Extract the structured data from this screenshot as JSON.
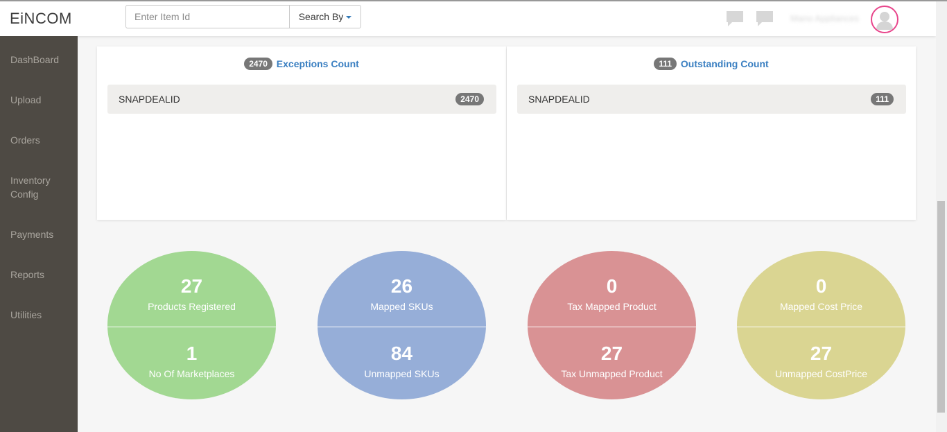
{
  "header": {
    "logo": "EiNCOM",
    "search_placeholder": "Enter Item Id",
    "search_by_label": "Search By",
    "user_name": "Mano Appliances"
  },
  "sidebar": {
    "items": [
      {
        "label": "DashBoard"
      },
      {
        "label": "Upload"
      },
      {
        "label": "Orders"
      },
      {
        "label": "Inventory Config"
      },
      {
        "label": "Payments"
      },
      {
        "label": "Reports"
      },
      {
        "label": "Utilities"
      }
    ]
  },
  "panels": {
    "exceptions": {
      "count": "2470",
      "title": "Exceptions Count",
      "row_label": "SNAPDEALID",
      "row_count": "2470"
    },
    "outstanding": {
      "count": "111",
      "title": "Outstanding Count",
      "row_label": "SNAPDEALID",
      "row_count": "111"
    }
  },
  "stats": [
    {
      "color": "#a2d892",
      "top_value": "27",
      "top_label": "Products Registered",
      "bottom_value": "1",
      "bottom_label": "No Of Marketplaces"
    },
    {
      "color": "#96aed8",
      "top_value": "26",
      "top_label": "Mapped SKUs",
      "bottom_value": "84",
      "bottom_label": "Unmapped SKUs"
    },
    {
      "color": "#d99294",
      "top_value": "0",
      "top_label": "Tax Mapped Product",
      "bottom_value": "27",
      "bottom_label": "Tax Unmapped Product"
    },
    {
      "color": "#dad592",
      "top_value": "0",
      "top_label": "Mapped Cost Price",
      "bottom_value": "27",
      "bottom_label": "Unmapped CostPrice"
    }
  ],
  "colors": {
    "accent": "#3a7fc1",
    "sidebar_bg": "#4e4a44",
    "avatar_ring": "#e8458b"
  }
}
